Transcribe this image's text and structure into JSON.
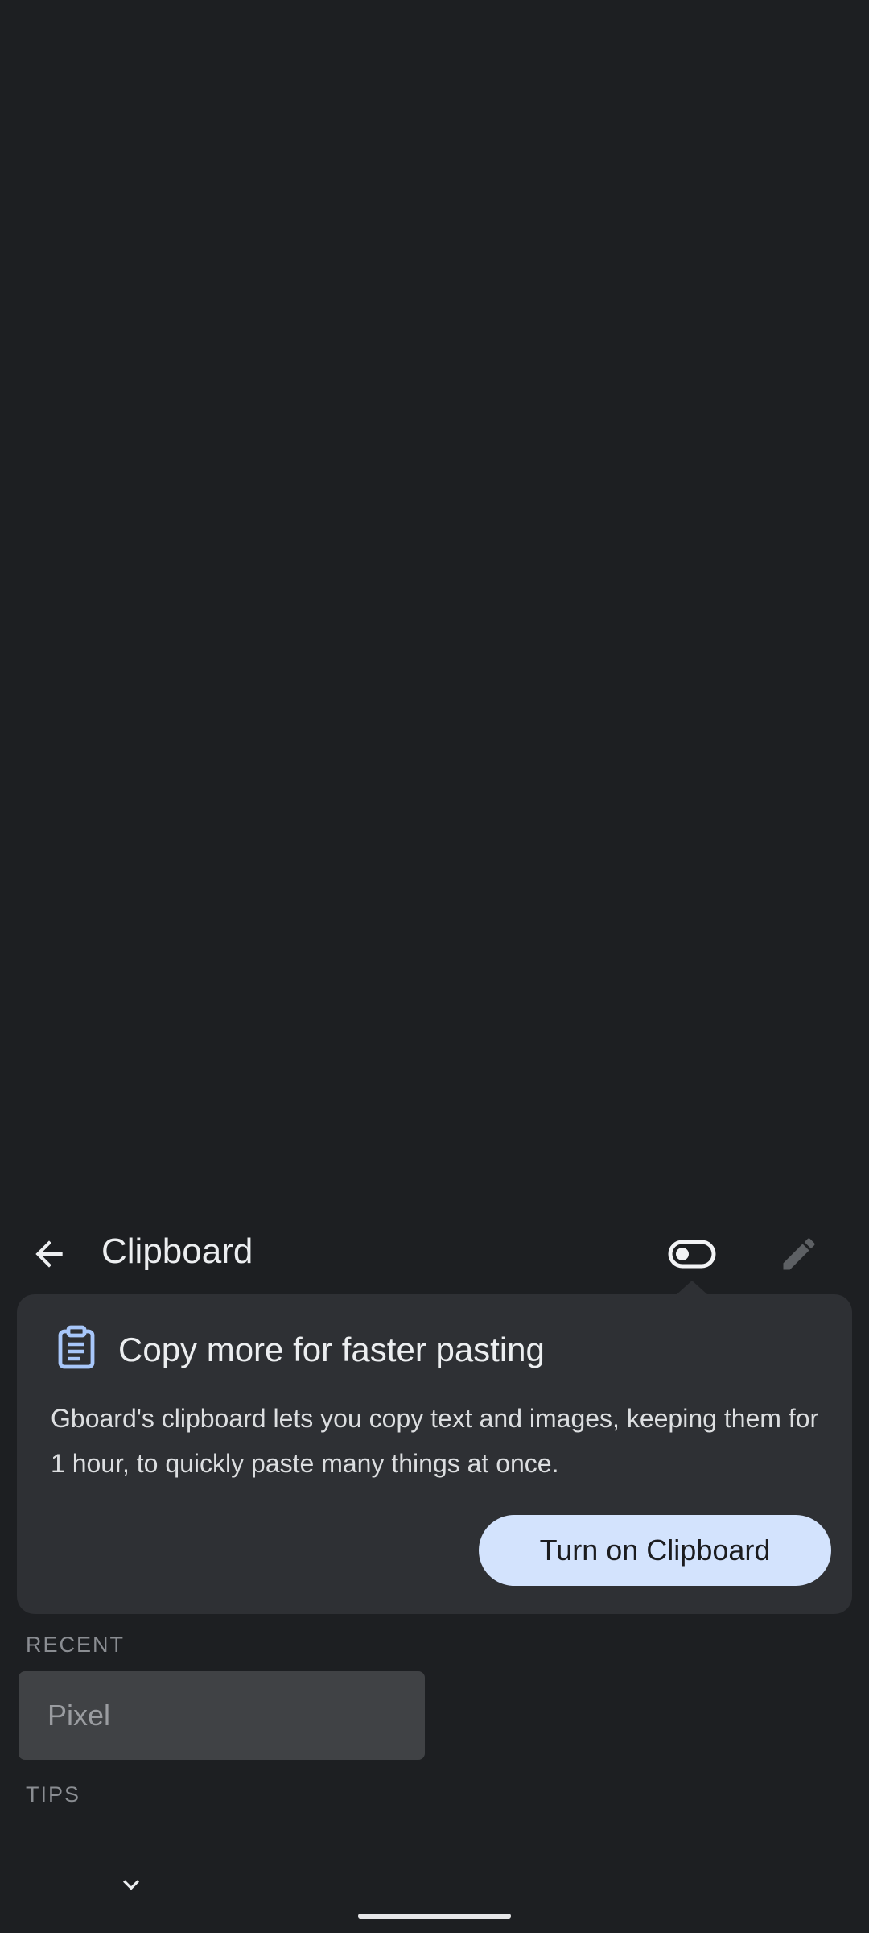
{
  "keyboard": {
    "header": {
      "back_icon": "arrow-back-icon",
      "title": "Clipboard",
      "toggle_icon": "toggle-off-icon",
      "edit_icon": "pencil-icon"
    },
    "promo": {
      "icon": "clipboard-icon",
      "title": "Copy more for faster pasting",
      "body": "Gboard's clipboard lets you copy text and images, keeping them for 1 hour, to quickly paste many things at once.",
      "button_label": "Turn on Clipboard"
    },
    "sections": {
      "recent_label": "RECENT",
      "tips_label": "TIPS"
    },
    "recent_items": [
      {
        "text": "Pixel"
      }
    ],
    "collapse_icon": "chevron-down-icon"
  },
  "colors": {
    "background": "#1d1f22",
    "card": "#2e3034",
    "accent_button": "#d3e3fd",
    "clip_item": "#404245"
  }
}
